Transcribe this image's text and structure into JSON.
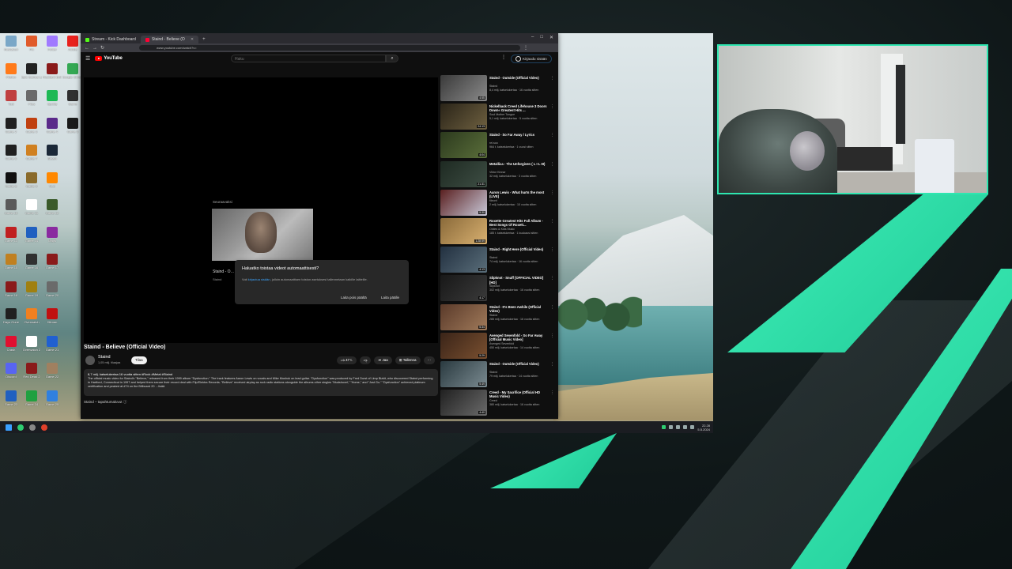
{
  "browser": {
    "tabs": [
      {
        "label": "Stream - Kick Dashboard",
        "color": "#53fc18"
      },
      {
        "label": "Staind - Believe (Official Video)",
        "color": "#ff0033"
      }
    ],
    "new_tab": "+",
    "url": "www.youtube.com/watch?v=",
    "window_controls": [
      "–",
      "□",
      "✕"
    ]
  },
  "youtube": {
    "logo_text": "YouTube",
    "search_placeholder": "Haku",
    "signin_label": "Kirjaudu sisään",
    "endscreen": {
      "label": "Seuraavaksi",
      "title": "Staind - O…",
      "channel": "Staind"
    },
    "dialog": {
      "title": "Haluatko toistaa videot automaattisesti?",
      "body_prefix": "Voit ",
      "body_link": "kirjautua sisään",
      "body_suffix": ", jolloin automaattisen toiston asetuksesi tallennetaan kaikille laitteille.",
      "btn_off": "Laita pois päältä",
      "btn_on": "Laita päälle"
    },
    "video": {
      "title": "Staind - Believe (Official Video)",
      "channel": "Staind",
      "subscribers": "1,05 milj. tilaajaa",
      "subscribe": "Tilaa",
      "likes": "47 t.",
      "share": "Jaa",
      "save": "Tallenna",
      "more": "⋯",
      "meta": "8,7 milj. katselukertaa  16 vuotta sitten  #Rock #Metal #Staind",
      "description": "The official music video for Staind's \"Believe,\" released from their 1999 album \"Dysfunction.\" The track features Aaron Lewis on vocals and Mike Mushok on lead guitar. \"Dysfunction\" was produced by Fred Durst of Limp Bizkit, who discovered Staind performing in Hartford, Connecticut in 1997 and helped them secure their record deal with Flip/Elektra Records. \"Believe\" received airplay as rock radio stations alongside the albums other singles \"Mudshovel,\" \"Home,\" and \"Just Go.\" \"Dysfunction\" achieved platinum certification and peaked at #74 on the Billboard 20 …lisää",
      "chapters_label": "Staind – tapahtumaluvut"
    },
    "recommendations": [
      {
        "title": "Staind - Outside (Official Video)",
        "channel": "Staind",
        "meta": "8,4 milj. katselukertaa · 16 vuotta sitten",
        "duration": "4:55",
        "c1": "#3a3a3a",
        "c2": "#8a8a8a"
      },
      {
        "title": "Nickelback Creed Lifehouse 3 Doors Down« Greatest Hits ...",
        "channel": "Soul Mother Tongue",
        "meta": "5,1 milj. katselukertaa · 5 vuotta sitten",
        "duration": "24:13",
        "c1": "#2a2418",
        "c2": "#6e6040"
      },
      {
        "title": "Staind - So Far Away / Lyrics",
        "channel": "rei.soo",
        "meta": "964 t. katselukertaa · 1 vuosi sitten",
        "duration": "4:04",
        "c1": "#2c3a1e",
        "c2": "#5a6e3a"
      },
      {
        "title": "Metallica - The Unforgiven ( L I L III)",
        "channel": "Viktor Kinnar",
        "meta": "32 milj. katselukertaa · 3 vuotta sitten",
        "duration": "21:31",
        "c1": "#1e2a22",
        "c2": "#3e4e44"
      },
      {
        "title": "Aaron Lewis - What hurts the most (LIVE)",
        "channel": "fileonf",
        "meta": "2 milj. katselukertaa · 10 vuotta sitten",
        "duration": "5:30",
        "c1": "#5a2020",
        "c2": "#c8c8d8"
      },
      {
        "title": "Roxette Greatest Hits Full Album - Best Songs Of Roxett...",
        "channel": "Oldies & Kids Music",
        "meta": "185 t. katselukertaa · 1 kuukausi sitten",
        "duration": "1:28:59",
        "c1": "#8a6a3a",
        "c2": "#d8b070"
      },
      {
        "title": "Staind - Right Here (Official Video)",
        "channel": "Staind",
        "meta": "74 milj. katselukertaa · 16 vuotta sitten",
        "duration": "4:13",
        "c1": "#223040",
        "c2": "#5a6e7a"
      },
      {
        "title": "Slipknot - Snuff [OFFICIAL VIDEO] [HD]",
        "channel": "Slipknot",
        "meta": "302 milj. katselukertaa · 16 vuotta sitten",
        "duration": "4:17",
        "c1": "#181818",
        "c2": "#3a3a3a"
      },
      {
        "title": "Staind - It's Been Awhile (Official Video)",
        "channel": "Staind",
        "meta": "285 milj. katselukertaa · 16 vuotta sitten",
        "duration": "5:34",
        "c1": "#5a3a2a",
        "c2": "#a07a5a"
      },
      {
        "title": "Avenged Sevenfold - So Far Away [Official Music Video]",
        "channel": "Avenged Sevenfold",
        "meta": "450 milj. katselukertaa · 14 vuotta sitten",
        "duration": "5:29",
        "c1": "#3a2418",
        "c2": "#7a5030"
      },
      {
        "title": "Staind - Outside (Official Video)",
        "channel": "Staind",
        "meta": "79 milj. katselukertaa · 14 vuotta sitten",
        "duration": "5:49",
        "c1": "#2a3a40",
        "c2": "#7a8a90"
      },
      {
        "title": "Creed - My Sacrifice (Official HD Music Video)",
        "channel": "Creed",
        "meta": "380 milj. katselukertaa · 16 vuotta sitten",
        "duration": "4:40",
        "c1": "#202020",
        "c2": "#6a6a6a"
      }
    ]
  },
  "desktop": {
    "icons": [
      {
        "label": "Roskakori",
        "color": "#7aa7c7"
      },
      {
        "label": "Pin",
        "color": "#e05a2a"
      },
      {
        "label": "Folder",
        "color": "#a07aff"
      },
      {
        "label": "Adobe",
        "color": "#e8211d"
      },
      {
        "label": "Firefox",
        "color": "#ff7a1a"
      },
      {
        "label": "Epic Games Launcher",
        "color": "#222222"
      },
      {
        "label": "Resident Evil",
        "color": "#8a1a1a"
      },
      {
        "label": "Google Chrome",
        "color": "#34a853"
      },
      {
        "label": "Tool",
        "color": "#c04040"
      },
      {
        "label": "Files",
        "color": "#6a6a6a"
      },
      {
        "label": "Spotify",
        "color": "#1db954"
      },
      {
        "label": "Game",
        "color": "#303030"
      },
      {
        "label": "Game 2",
        "color": "#202020"
      },
      {
        "label": "Game 3",
        "color": "#c04010"
      },
      {
        "label": "Game 4",
        "color": "#5a2a8a"
      },
      {
        "label": "Game 5",
        "color": "#1a1a1a"
      },
      {
        "label": "Game 6",
        "color": "#202020"
      },
      {
        "label": "Game 7",
        "color": "#d08020"
      },
      {
        "label": "Steam",
        "color": "#1b2838"
      },
      {
        "label": "",
        "color": "#00000000"
      },
      {
        "label": "Game 8",
        "color": "#101010"
      },
      {
        "label": "Game 9",
        "color": "#8a6a2a"
      },
      {
        "label": "VLC",
        "color": "#ff8800"
      },
      {
        "label": "",
        "color": "#00000000"
      },
      {
        "label": "Game 10",
        "color": "#5a5a5a"
      },
      {
        "label": "Game 11",
        "color": "#ffffff"
      },
      {
        "label": "Game 12",
        "color": "#3a5a2a"
      },
      {
        "label": "",
        "color": "#00000000"
      },
      {
        "label": "Game 13",
        "color": "#c02020"
      },
      {
        "label": "Game 14",
        "color": "#2060c0"
      },
      {
        "label": "Maps",
        "color": "#8a2aa0"
      },
      {
        "label": "",
        "color": "#00000000"
      },
      {
        "label": "Game 15",
        "color": "#c08020"
      },
      {
        "label": "Game 16",
        "color": "#303030"
      },
      {
        "label": "Game 17",
        "color": "#8a1a1a"
      },
      {
        "label": "",
        "color": "#00000000"
      },
      {
        "label": "Game 18",
        "color": "#8a1a1a"
      },
      {
        "label": "Game 19",
        "color": "#a08010"
      },
      {
        "label": "Game 20",
        "color": "#6a6a6a"
      },
      {
        "label": "",
        "color": "#00000000"
      },
      {
        "label": "Days Gone",
        "color": "#202020"
      },
      {
        "label": "Overwatch",
        "color": "#f08020"
      },
      {
        "label": "Hitman",
        "color": "#c01010"
      },
      {
        "label": "",
        "color": "#00000000"
      },
      {
        "label": "Crash",
        "color": "#e01030"
      },
      {
        "label": "Overwatch 2",
        "color": "#ffffff"
      },
      {
        "label": "Game 21",
        "color": "#2060d0"
      },
      {
        "label": "",
        "color": "#00000000"
      },
      {
        "label": "Discord",
        "color": "#5865f2"
      },
      {
        "label": "Red Dead 2",
        "color": "#8a1a1a"
      },
      {
        "label": "Game 22",
        "color": "#a08060"
      },
      {
        "label": "",
        "color": "#00000000"
      },
      {
        "label": "Game 23",
        "color": "#2060c0"
      },
      {
        "label": "Game 24",
        "color": "#20a040"
      },
      {
        "label": "Game 25",
        "color": "#3080e0"
      },
      {
        "label": "",
        "color": "#00000000"
      }
    ],
    "taskbar_icons": [
      "#3aa0ff",
      "#2ecc71",
      "#888888",
      "#e0402a"
    ],
    "clock_time": "22.28",
    "clock_date": "5.5.2024"
  }
}
